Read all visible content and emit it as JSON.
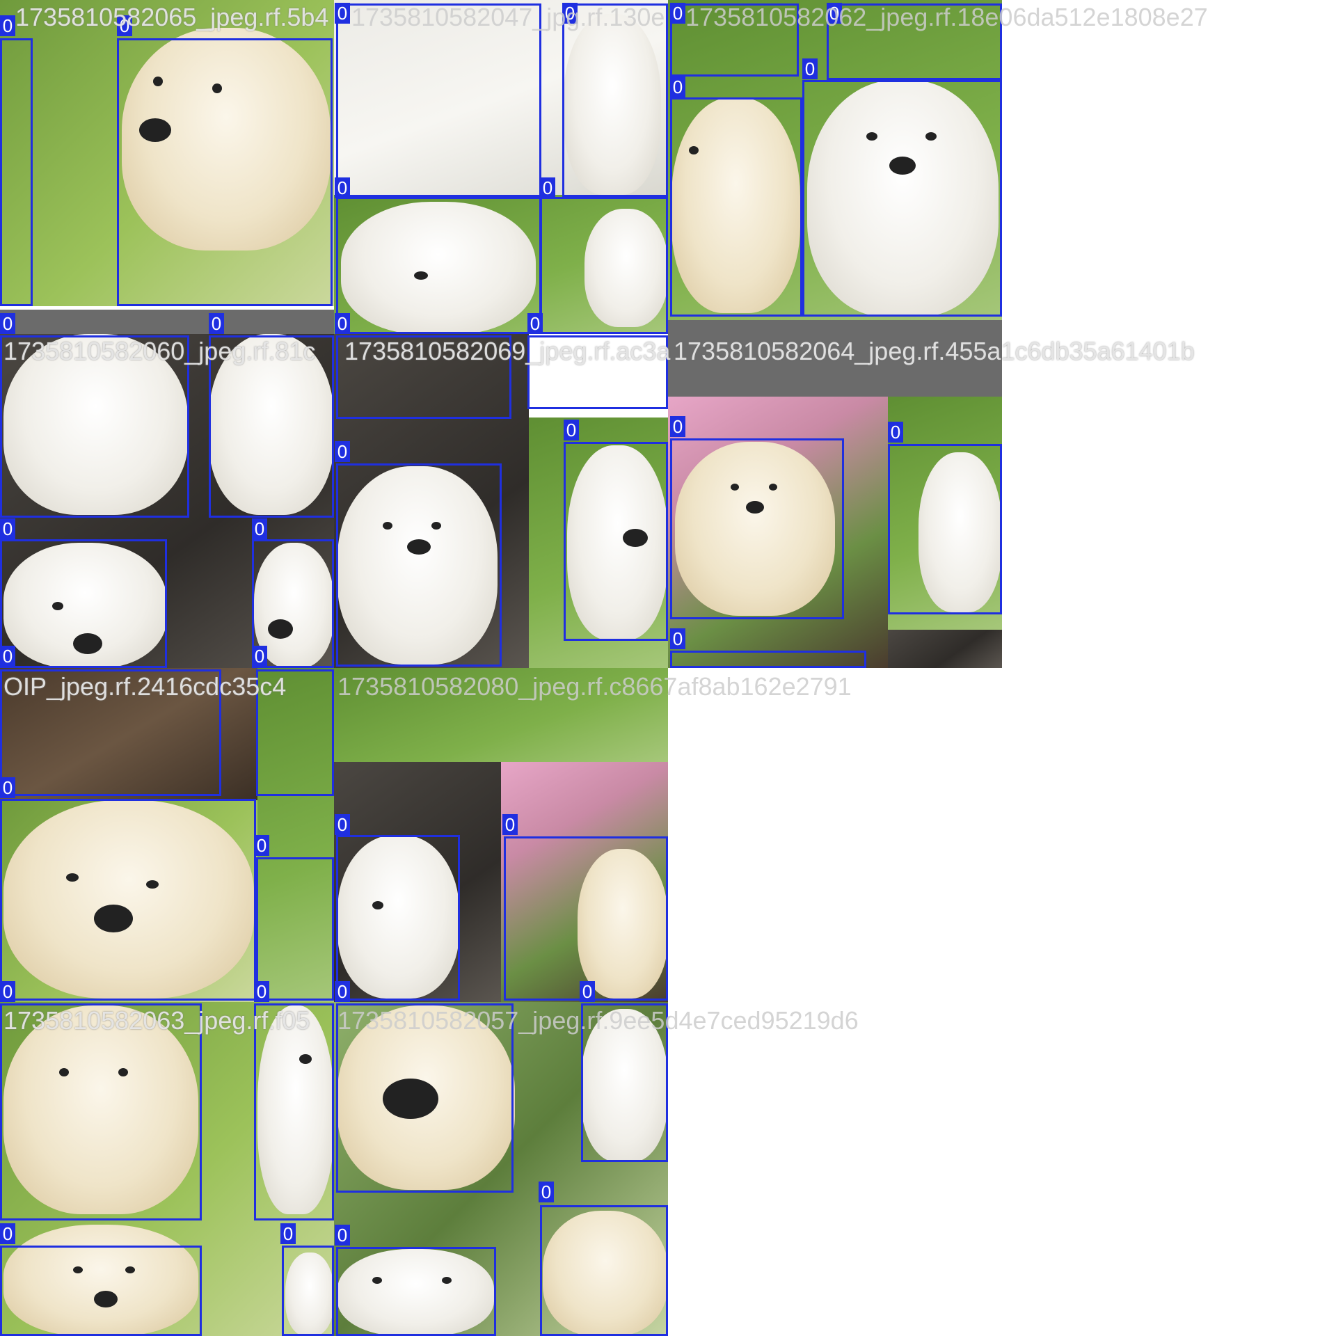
{
  "mosaic": {
    "file_labels": [
      "1735810582065_jpeg.rf.5b4",
      "1735810582047_jpg.rf.130e",
      "1735810582062_jpeg.rf.18e06da512e1808e27",
      "1735810582060_jpeg.rf.81c",
      "1735810582069_jpeg.rf.ac3a",
      "1735810582064_jpeg.rf.455a1c6db35a61401b",
      "OIP_jpeg.rf.2416cdc35c4",
      "1735810582080_jpeg.rf.c8667af8ab162e2791",
      "1735810582063_jpeg.rf.f05",
      "1735810582057_jpeg.rf.9ee5d4e7ced95219d6"
    ],
    "box_label": "0"
  }
}
